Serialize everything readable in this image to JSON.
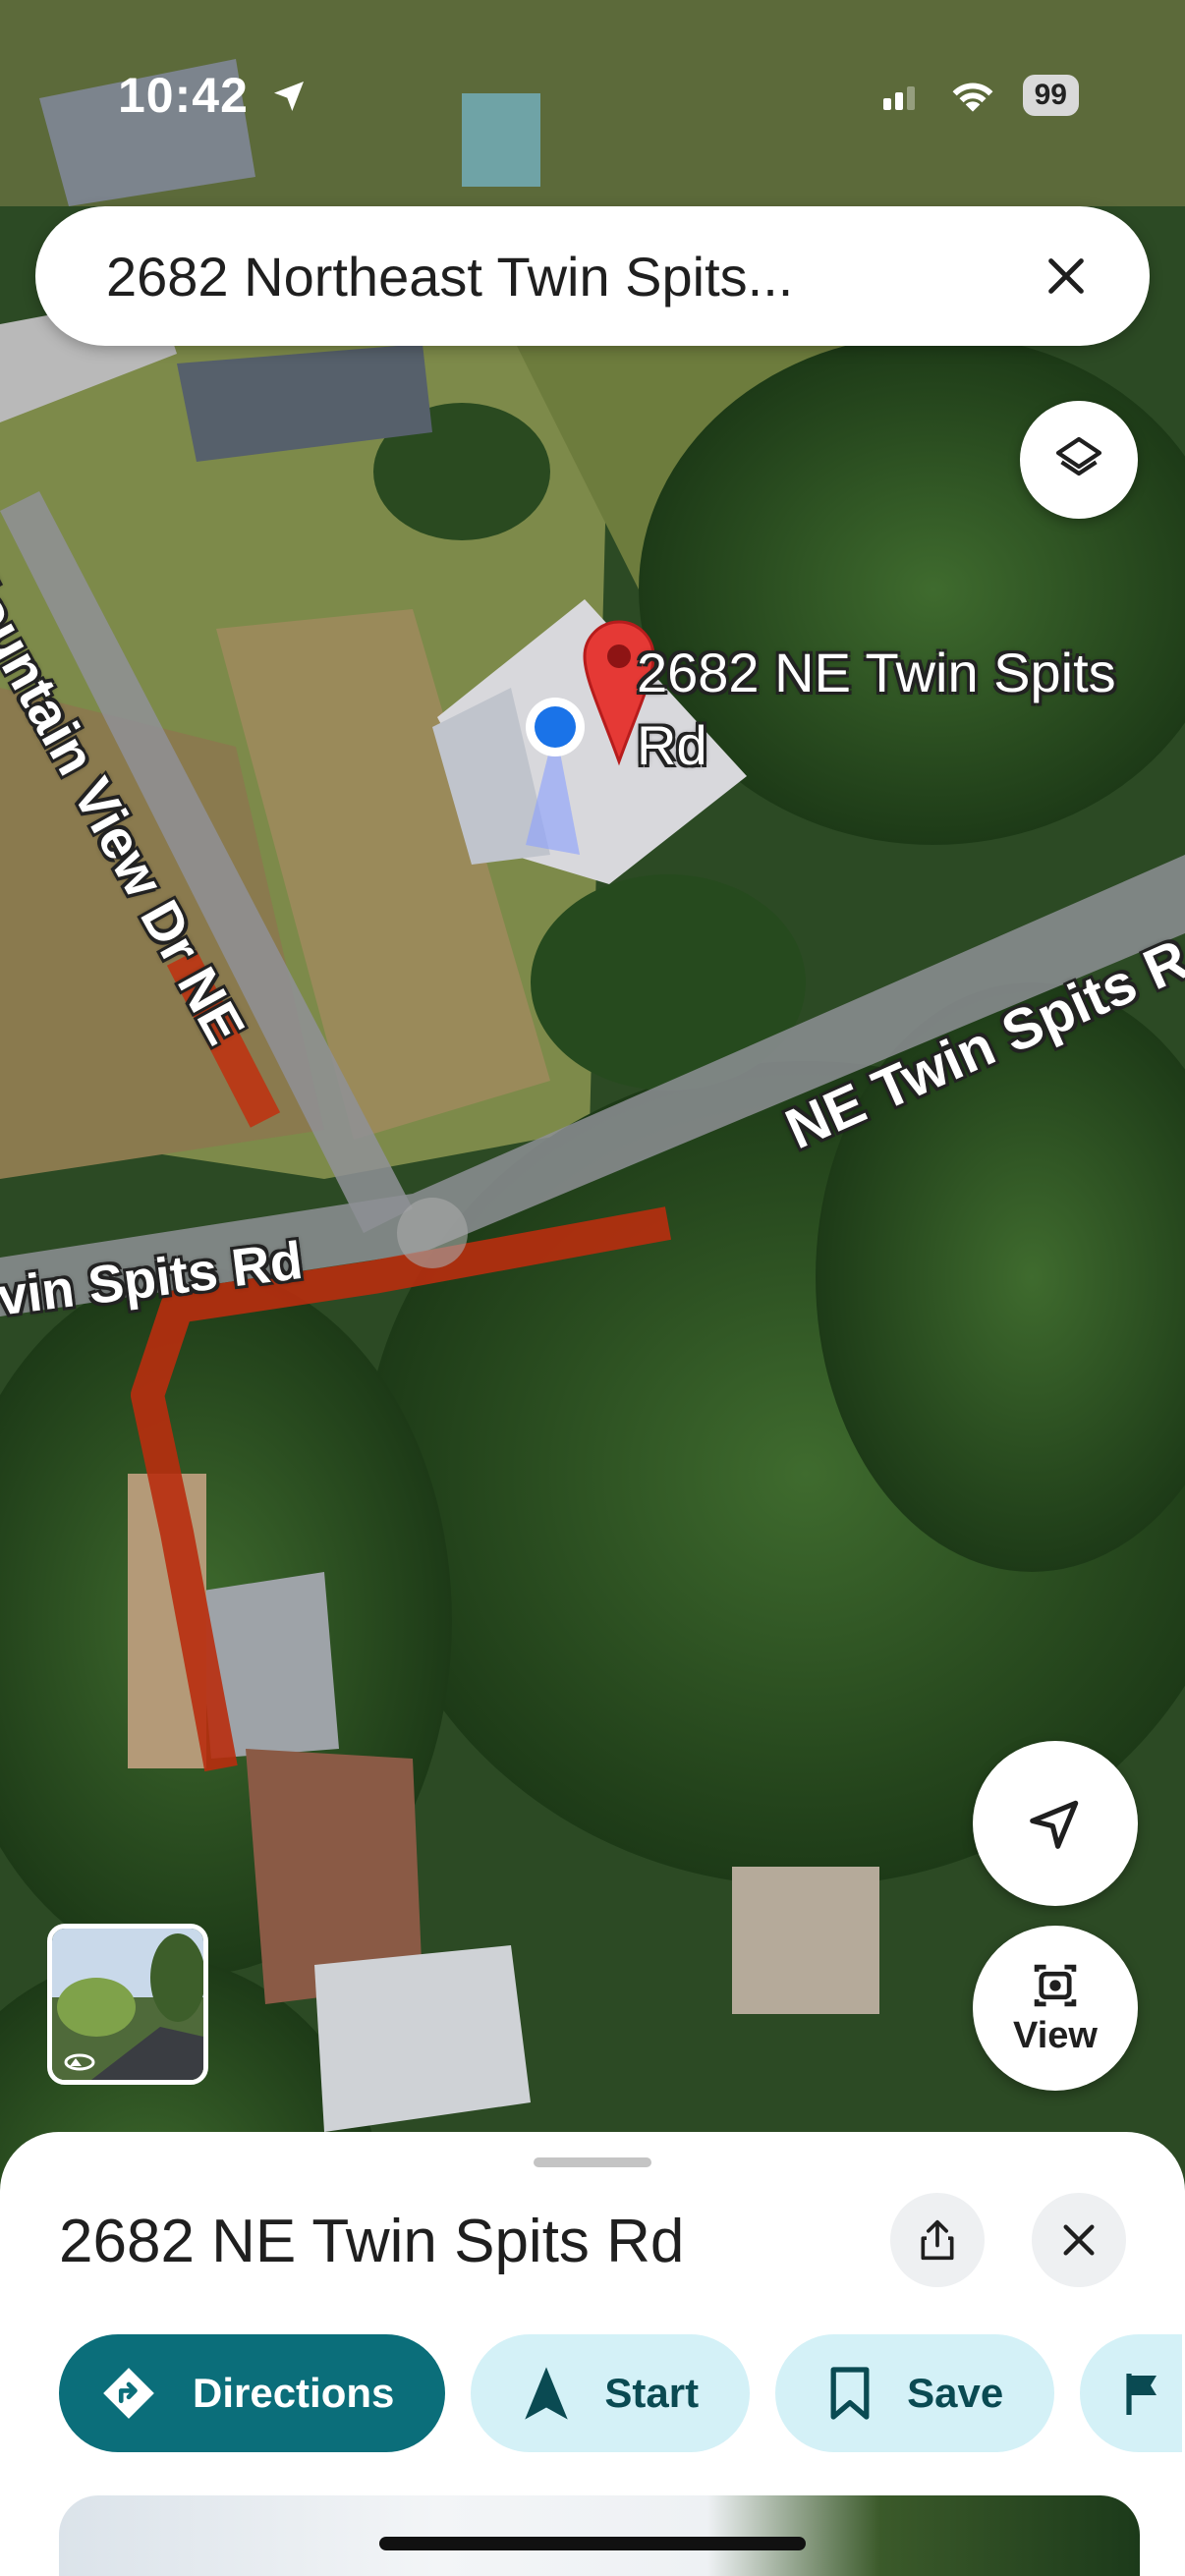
{
  "status_bar": {
    "time": "10:42",
    "battery": "99"
  },
  "search": {
    "query": "2682 Northeast Twin Spits..."
  },
  "map": {
    "place_label": "2682 NE Twin Spits Rd",
    "road_labels": {
      "mountain_view": "Mountain View Dr NE",
      "twin_spits_right": "NE Twin Spits R",
      "twin_spits_left": "vin Spits Rd"
    },
    "view_label": "View"
  },
  "sheet": {
    "title": "2682 NE Twin Spits Rd",
    "actions": {
      "directions": "Directions",
      "start": "Start",
      "save": "Save"
    }
  },
  "colors": {
    "primary": "#0b6e7a",
    "chip_secondary": "#d4f1f7",
    "pin_red": "#e53935",
    "location_blue": "#1a73e8",
    "route_red": "#c0300f"
  },
  "icons": [
    "navigation-arrow-icon",
    "wifi-icon",
    "close-icon",
    "layers-icon",
    "location-arrow-icon",
    "camera-icon",
    "share-icon",
    "directions-icon",
    "start-icon",
    "bookmark-icon",
    "flag-icon"
  ]
}
